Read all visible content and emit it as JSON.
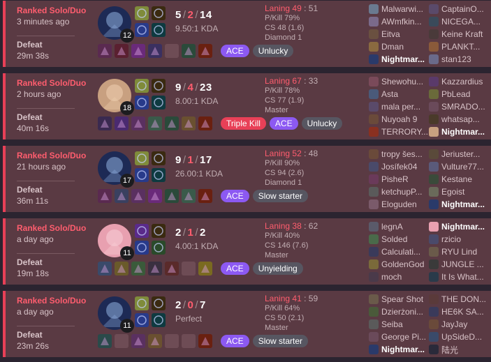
{
  "matches": [
    {
      "queue": "Ranked Solo/Duo",
      "time_ago": "3 minutes ago",
      "result": "Defeat",
      "duration": "29m 38s",
      "champ_color": "#1d2a55",
      "champ_accent": "#8fb0e0",
      "level": "12",
      "spells": [
        "#7f8b3a",
        "#283a8a"
      ],
      "runes": [
        "#3a2a10",
        "#0e3a40"
      ],
      "kills": "5",
      "deaths": "2",
      "assists": "14",
      "kda_ratio": "9.50:1 KDA",
      "items": [
        "#5a2a50",
        "#5a2030",
        "#6a2a7a",
        "#3a3060",
        "empty",
        "#2a4a3a",
        "#6a2010"
      ],
      "badges": [
        {
          "label": "ACE",
          "type": "ace"
        },
        {
          "label": "Unlucky",
          "type": "tag"
        }
      ],
      "laning_label": "Laning",
      "laning_a": "49",
      "laning_sep": ":",
      "laning_b": "51",
      "pkill": "P/Kill 79%",
      "cs": "CS 48 (1.6)",
      "rank": "Diamond 1",
      "team1": [
        {
          "name": "Malwarwi...",
          "c": "#6a7a90"
        },
        {
          "name": "AWmfkin...",
          "c": "#7a6a8a"
        },
        {
          "name": "Eitva",
          "c": "#6a5040"
        },
        {
          "name": "Dman",
          "c": "#8a6a40"
        },
        {
          "name": "Nightmar...",
          "c": "#2a3a6a",
          "me": true
        }
      ],
      "team2": [
        {
          "name": "CaptainO...",
          "c": "#5a4a6a"
        },
        {
          "name": "NICEGA...",
          "c": "#3a4a5a"
        },
        {
          "name": "Keine Kraft",
          "c": "#4a3a3a"
        },
        {
          "name": "PLANKT...",
          "c": "#8a5a3a"
        },
        {
          "name": "stan123",
          "c": "#6a6a8a"
        }
      ]
    },
    {
      "queue": "Ranked Solo/Duo",
      "time_ago": "2 hours ago",
      "result": "Defeat",
      "duration": "40m 16s",
      "champ_color": "#c8a080",
      "champ_accent": "#f0d0b0",
      "level": "18",
      "spells": [
        "#7f8b3a",
        "#283a8a"
      ],
      "runes": [
        "#3a2a10",
        "#0e3a40"
      ],
      "kills": "9",
      "deaths": "4",
      "assists": "23",
      "kda_ratio": "8.00:1 KDA",
      "items": [
        "#3a2a50",
        "#4a2a70",
        "#5a3060",
        "#3a5a4a",
        "#2a4a3a",
        "#6a5030",
        "#6a2010"
      ],
      "badges": [
        {
          "label": "Triple Kill",
          "type": "kill"
        },
        {
          "label": "ACE",
          "type": "ace"
        },
        {
          "label": "Unlucky",
          "type": "tag"
        }
      ],
      "laning_label": "Laning",
      "laning_a": "67",
      "laning_sep": ":",
      "laning_b": "33",
      "pkill": "P/Kill 78%",
      "cs": "CS 77 (1.9)",
      "rank": "Master",
      "team1": [
        {
          "name": "Shewohu...",
          "c": "#7a4a5a"
        },
        {
          "name": "Asta",
          "c": "#4a5a7a"
        },
        {
          "name": "mala per...",
          "c": "#5a4a6a"
        },
        {
          "name": "Nuyoah 9",
          "c": "#6a4a3a"
        },
        {
          "name": "TERRORY...",
          "c": "#8a3020"
        }
      ],
      "team2": [
        {
          "name": "Kazzardius",
          "c": "#5a3a6a"
        },
        {
          "name": "PbLead",
          "c": "#6a6a3a"
        },
        {
          "name": "SMRADO...",
          "c": "#6a4a5a"
        },
        {
          "name": "whatsap...",
          "c": "#4a3a2a"
        },
        {
          "name": "Nightmar...",
          "c": "#c8a080",
          "me": true
        }
      ]
    },
    {
      "queue": "Ranked Solo/Duo",
      "time_ago": "21 hours ago",
      "result": "Defeat",
      "duration": "36m 11s",
      "champ_color": "#1d2a55",
      "champ_accent": "#8fb0e0",
      "level": "17",
      "spells": [
        "#7f8b3a",
        "#283a8a"
      ],
      "runes": [
        "#3a2a10",
        "#0e3a40"
      ],
      "kills": "9",
      "deaths": "1",
      "assists": "17",
      "kda_ratio": "26.00:1 KDA",
      "items": [
        "#5a2a50",
        "#3a4060",
        "#5a3060",
        "#6a2a7a",
        "#2a4a3a",
        "#3a5a4a",
        "#6a2010"
      ],
      "badges": [
        {
          "label": "ACE",
          "type": "ace"
        },
        {
          "label": "Slow starter",
          "type": "tag"
        }
      ],
      "laning_label": "Laning",
      "laning_a": "52",
      "laning_sep": ":",
      "laning_b": "48",
      "pkill": "P/Kill 90%",
      "cs": "CS 94 (2.6)",
      "rank": "Diamond 1",
      "team1": [
        {
          "name": "tropy šes...",
          "c": "#6a4a3a"
        },
        {
          "name": "Josífek04",
          "c": "#4a4a6a"
        },
        {
          "name": "PisheR",
          "c": "#6a3a5a"
        },
        {
          "name": "ketchupP...",
          "c": "#5a5a5a"
        },
        {
          "name": "Eloguden",
          "c": "#7a5a6a"
        }
      ],
      "team2": [
        {
          "name": "Jeriuster...",
          "c": "#5a4a3a"
        },
        {
          "name": "Vulture77...",
          "c": "#5a5a7a"
        },
        {
          "name": "Kestane",
          "c": "#3a4a3a"
        },
        {
          "name": "Egoist",
          "c": "#6a6a5a"
        },
        {
          "name": "Nightmar...",
          "c": "#2a3a6a",
          "me": true
        }
      ]
    },
    {
      "queue": "Ranked Solo/Duo",
      "time_ago": "a day ago",
      "result": "Defeat",
      "duration": "19m 18s",
      "champ_color": "#e8a0b0",
      "champ_accent": "#f8d0d8",
      "level": "11",
      "spells": [
        "#5a2a8a",
        "#283a8a"
      ],
      "runes": [
        "#3a2a10",
        "#2a4a2a"
      ],
      "kills": "2",
      "deaths": "1",
      "assists": "2",
      "kda_ratio": "4.00:1 KDA",
      "items": [
        "#3a4a6a",
        "#6a5a2a",
        "#3a5a3a",
        "#3a3040",
        "#5a2a2a",
        "empty",
        "#7a6a20"
      ],
      "badges": [
        {
          "label": "ACE",
          "type": "ace"
        },
        {
          "label": "Unyielding",
          "type": "tag"
        }
      ],
      "laning_label": "Laning",
      "laning_a": "38",
      "laning_sep": ":",
      "laning_b": "62",
      "pkill": "P/Kill 40%",
      "cs": "CS 146 (7.6)",
      "rank": "Master",
      "team1": [
        {
          "name": "legnA",
          "c": "#5a5a6a"
        },
        {
          "name": "Solded",
          "c": "#4a6a4a"
        },
        {
          "name": "Calculati...",
          "c": "#3a3a5a"
        },
        {
          "name": "GoldenGod",
          "c": "#7a6a3a"
        },
        {
          "name": "moch",
          "c": "#4a3a4a"
        }
      ],
      "team2": [
        {
          "name": "Nightmar...",
          "c": "#e8a0b0",
          "me": true
        },
        {
          "name": "rzicio",
          "c": "#4a4a6a"
        },
        {
          "name": "RYU Lind",
          "c": "#6a5a4a"
        },
        {
          "name": "JUNGLE ...",
          "c": "#3a3a3a"
        },
        {
          "name": "It Is What...",
          "c": "#2a3a4a"
        }
      ]
    },
    {
      "queue": "Ranked Solo/Duo",
      "time_ago": "a day ago",
      "result": "Defeat",
      "duration": "23m 26s",
      "champ_color": "#1d2a55",
      "champ_accent": "#8fb0e0",
      "level": "11",
      "spells": [
        "#7f8b3a",
        "#283a8a"
      ],
      "runes": [
        "#3a2a10",
        "#0e3a40"
      ],
      "kills": "2",
      "deaths": "0",
      "assists": "7",
      "kda_ratio": "Perfect",
      "items": [
        "#2a4a4a",
        "empty",
        "#5a3060",
        "#6a5030",
        "empty",
        "empty",
        "#6a2010"
      ],
      "badges": [
        {
          "label": "ACE",
          "type": "ace"
        },
        {
          "label": "Slow starter",
          "type": "tag"
        }
      ],
      "laning_label": "Laning",
      "laning_a": "41",
      "laning_sep": ":",
      "laning_b": "59",
      "pkill": "P/Kill 64%",
      "cs": "CS 50 (2.1)",
      "rank": "Master",
      "team1": [
        {
          "name": "Spear Shot",
          "c": "#6a5a4a"
        },
        {
          "name": "Dzierżoni...",
          "c": "#4a5a3a"
        },
        {
          "name": "Seiba",
          "c": "#5a5a5a"
        },
        {
          "name": "George Pi...",
          "c": "#6a4a5a"
        },
        {
          "name": "Nightmar...",
          "c": "#2a3a6a",
          "me": true
        }
      ],
      "team2": [
        {
          "name": "THE DON...",
          "c": "#5a3a3a"
        },
        {
          "name": "HE6K SA...",
          "c": "#3a3a5a"
        },
        {
          "name": "JayJay",
          "c": "#6a4a3a"
        },
        {
          "name": "UpSideD...",
          "c": "#3a4a6a"
        },
        {
          "name": "陆光",
          "c": "#2a2a3a"
        }
      ]
    }
  ]
}
